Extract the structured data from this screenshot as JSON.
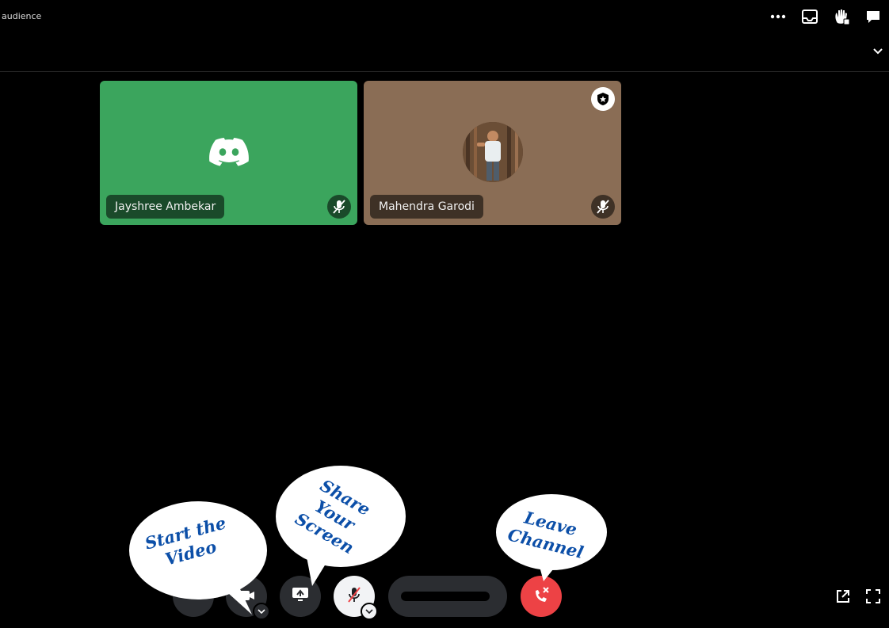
{
  "header": {
    "channel_label": "audience"
  },
  "participants": [
    {
      "name": "Jayshree Ambekar",
      "tile_color": "#3ba55d",
      "muted": true,
      "avatar": "discord-logo"
    },
    {
      "name": "Mahendra Garodi",
      "tile_color": "#8a6d55",
      "muted": true,
      "avatar": "profile-photo",
      "badge": "shield-star-icon"
    }
  ],
  "controls": {
    "camera": "camera-icon",
    "share_screen": "share-screen-icon",
    "microphone": "mic-off-icon",
    "activity": "activity-button",
    "leave": "leave-call-icon",
    "leave_color": "#ed4245"
  },
  "annotations": {
    "start_video": "Start the\nVideo",
    "share_screen": "Share\nYour\nScreen",
    "leave_channel": "Leave\nChannel"
  }
}
